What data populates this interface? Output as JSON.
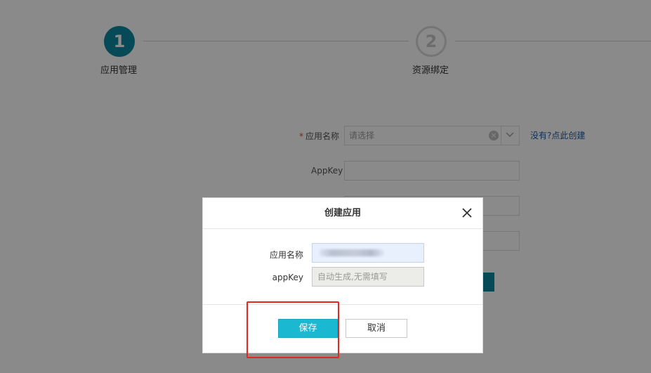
{
  "steps": [
    {
      "number": "1",
      "label": "应用管理",
      "state": "active"
    },
    {
      "number": "2",
      "label": "资源绑定",
      "state": "pending"
    }
  ],
  "form": {
    "app_name_label": "应用名称",
    "app_name_required_mark": "*",
    "app_name_placeholder": "请选择",
    "create_link": "没有?点此创建",
    "appkey_label": "AppKey"
  },
  "dialog": {
    "title": "创建应用",
    "name_label": "应用名称",
    "appkey_label": "appKey",
    "appkey_placeholder": "自动生成,无需填写",
    "save_label": "保存",
    "cancel_label": "取消"
  },
  "colors": {
    "accent": "#0b8aa0",
    "save_button": "#1bb8d1",
    "highlight": "#e5271d",
    "link": "#1d5ca5"
  }
}
